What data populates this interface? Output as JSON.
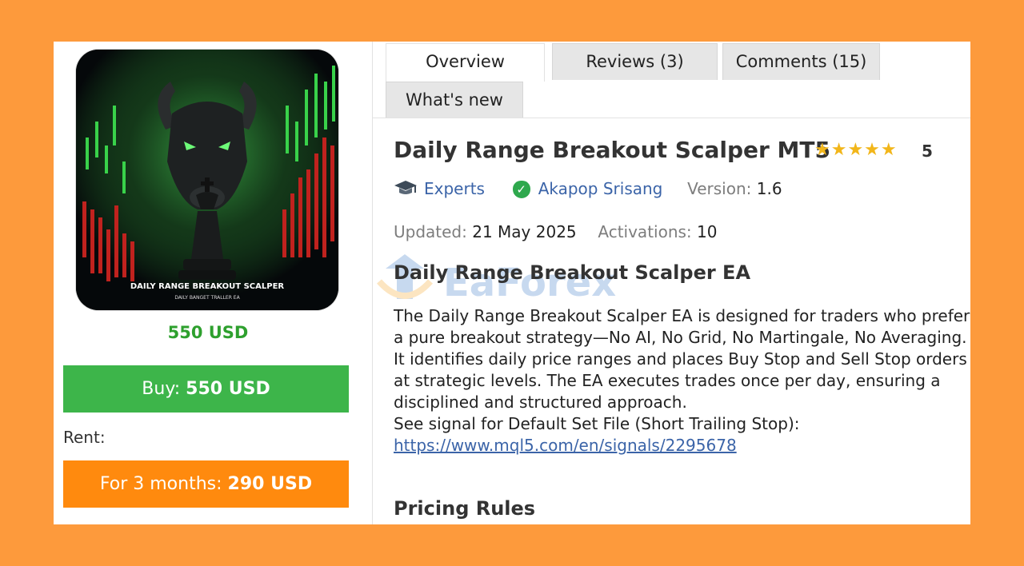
{
  "product": {
    "image_caption": "DAILY RANGE BREAKOUT SCALPER",
    "image_subcaption": "DAILY BANGET TRALLER EA",
    "price": "550 USD",
    "buy_label": "Buy: ",
    "buy_price": "550 USD",
    "rent_label": "Rent:",
    "rent_option_label": "For 3 months: ",
    "rent_option_price": "290 USD"
  },
  "tabs": [
    {
      "label": "Overview",
      "active": true
    },
    {
      "label": "Reviews (3)",
      "active": false
    },
    {
      "label": "Comments (15)",
      "active": false
    },
    {
      "label": "What's new",
      "active": false
    }
  ],
  "header": {
    "title": "Daily Range Breakout Scalper MT5",
    "stars": "★★★★★",
    "rating": "5"
  },
  "meta": {
    "category": "Experts",
    "author": "Akapop Srisang",
    "version_label": "Version:",
    "version": "1.6",
    "updated_label": "Updated:",
    "updated": "21 May 2025",
    "activations_label": "Activations:",
    "activations": "10"
  },
  "watermark": "EaForex",
  "description": {
    "heading": "Daily Range Breakout Scalper EA",
    "paragraph": "The Daily Range Breakout Scalper EA is designed for traders who prefer a pure breakout strategy—No AI, No Grid, No Martingale, No Averaging. It identifies daily price ranges and places Buy Stop and Sell Stop orders at strategic levels. The EA executes trades once per day, ensuring a disciplined and structured approach.",
    "signal_text": "See signal for Default Set File (Short Trailing Stop):",
    "signal_link": "https://www.mql5.com/en/signals/2295678"
  },
  "pricing_heading": "Pricing Rules",
  "colors": {
    "page_bg": "#fd9a3c",
    "buy": "#3db54a",
    "rent": "#ff8a0e",
    "price_text": "#2ea02e",
    "link": "#3b64a8",
    "star": "#f2b61a"
  }
}
